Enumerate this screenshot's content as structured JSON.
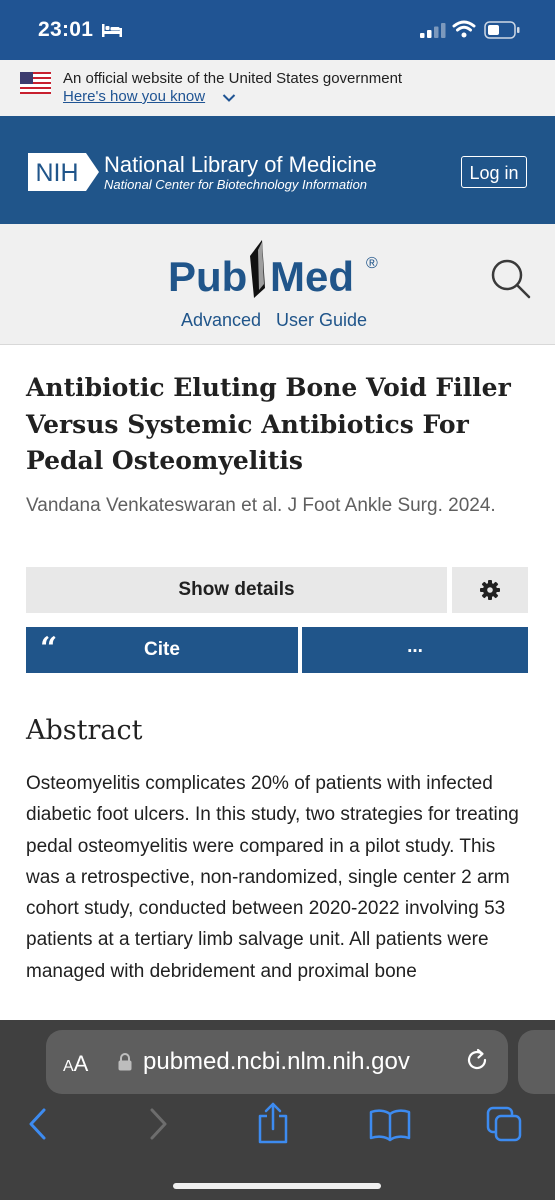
{
  "status": {
    "time": "23:01"
  },
  "gov_banner": {
    "line1": "An official website of the United States government",
    "link": "Here's how you know"
  },
  "nih": {
    "logo_text": "NIH",
    "title": "National Library of Medicine",
    "subtitle": "National Center for Biotechnology Information",
    "login": "Log in"
  },
  "pubmed": {
    "logo_left": "Pub",
    "logo_right": "Med",
    "registered": "®",
    "advanced": "Advanced",
    "user_guide": "User Guide"
  },
  "article": {
    "title": "Antibiotic Eluting Bone Void Filler Versus Systemic Antibiotics For Pedal Osteomyelitis",
    "authors_journal": "Vandana Venkateswaran et al. J Foot Ankle Surg. 2024."
  },
  "actions": {
    "show_details": "Show details",
    "cite_quote": "“",
    "cite": "Cite",
    "more": "..."
  },
  "abstract": {
    "heading": "Abstract",
    "text": "Osteomyelitis complicates 20% of patients with infected diabetic foot ulcers. In this study, two strategies for treating pedal osteomyelitis were compared in a pilot study. This was a retrospective, non-randomized, single center 2 arm cohort study, conducted between 2020-2022 involving 53 patients at a tertiary limb salvage unit. All patients were managed with debridement and proximal bone"
  },
  "browser": {
    "aa_small": "A",
    "aa_big": "A",
    "url": "pubmed.ncbi.nlm.nih.gov"
  },
  "colors": {
    "nih_blue": "#20558a",
    "status_blue": "#205493",
    "safari_bar": "#404040"
  }
}
